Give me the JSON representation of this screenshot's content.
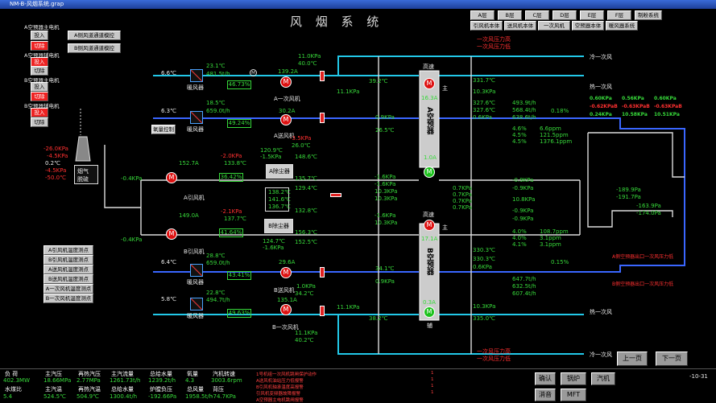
{
  "window": {
    "title": "NM-B-风烟系统.grap"
  },
  "page_title": "风 烟 系 统",
  "area_tabs": [
    "A层",
    "B层",
    "C层",
    "D层",
    "E层",
    "F层",
    "制粉系统"
  ],
  "subsystem_tabs": [
    "引风机本体",
    "送风机本体",
    "一次风机",
    "空预器本体",
    "暖风器系统"
  ],
  "left_controls": {
    "a_heater_main": "A空预器主电机",
    "a_heater_aux": "A空预器辅电机",
    "b_heater_main": "B空预器主电机",
    "b_heater_aux": "B空预器辅电机",
    "input": "投入",
    "switch": "切除",
    "a_duct": "A侧风道通道模控",
    "b_duct": "B侧风道通道模控",
    "o2_ctrl": "氧量控制"
  },
  "stack": {
    "values": [
      "-26.0KPa",
      "-4.5KPa",
      "0.2℃",
      "-4.5KPa",
      "-50.0℃"
    ],
    "desulf": "脱硫",
    "flue": "烟气"
  },
  "temp_buttons": [
    "A引风机温度测点",
    "B引风机温度测点",
    "A送风机温度测点",
    "B送风机温度测点",
    "A一次风机温度测点",
    "B一次风机温度测点"
  ],
  "upper": {
    "a_sec_fan": {
      "in_temp": "6.6℃",
      "heater_t": "23.1℃",
      "flow": "481.5t/h",
      "pct": "46.73%",
      "amp": "139.2A",
      "p": "11.0KPa",
      "t": "40.0℃",
      "name": "A一次风机",
      "heater": "暖风器"
    },
    "a_send_fan": {
      "in_temp": "6.3℃",
      "heater_t": "18.5℃",
      "flow": "659.0t/h",
      "pct": "49.24%",
      "amp": "30.2A",
      "p": "-3.5KPa",
      "t": "26.0℃",
      "name": "A送风机",
      "heater": "暖风器"
    },
    "a_pre": {
      "mid_p": "11.1KPa",
      "t1": "39.2℃",
      "p2": "0.9KPa",
      "t2": "26.5℃",
      "label": "A空预器",
      "speed": "高速",
      "amp": "16.3A",
      "main": "主"
    }
  },
  "lower": {
    "b_send_fan": {
      "in_temp": "6.4℃",
      "heater_t": "28.8℃",
      "flow": "659.0t/h",
      "pct": "43.41%",
      "amp": "29.6A",
      "p": "1.0KPa",
      "t": "34.2℃",
      "name": "B送风机",
      "heater": "暖风器"
    },
    "b_sec_fan": {
      "in_temp": "5.8℃",
      "heater_t": "22.8℃",
      "flow": "494.7t/h",
      "pct": "49.63%",
      "amp": "135.1A",
      "p": "11.1KPa",
      "t": "40.2℃",
      "name": "B一次风机",
      "heater": "暖风器"
    },
    "b_pre": {
      "t1": "34.1℃",
      "p": "0.9KPa",
      "mid_p": "11.1KPa",
      "t2": "38.2℃",
      "label": "B空预器",
      "speed": "高速",
      "amp": "17.1A",
      "aux_amp": "0.3A",
      "aux": "辅",
      "main": "主"
    }
  },
  "induced": {
    "a": {
      "in_p": "-0.4KPa",
      "amp": "152.7A",
      "p": "-2.0KPa",
      "t": "133.8℃",
      "pct": "36.42%",
      "name": "A引风机"
    },
    "b": {
      "in_p": "-0.4KPa",
      "amp": "149.0A",
      "p": "-2.1KPa",
      "t": "137.7℃",
      "pct": "41.64%",
      "name": "B引风机"
    }
  },
  "dust": {
    "a": {
      "label": "A除尘器",
      "t_in": "120.9℃",
      "p_in": "-1.5KPa",
      "t2": "148.6℃",
      "t3": "135.7℃",
      "t4": "129.4℃"
    },
    "b": {
      "label": "B除尘器",
      "t_in": "138.2℃",
      "t2": "141.6℃",
      "t3": "136.7℃",
      "t4": "132.8℃",
      "t5": "156.3℃",
      "t6": "152.5℃",
      "t7": "124.7℃",
      "p": "-1.6KPa"
    }
  },
  "mid_values": [
    "-1.6KPa",
    "-1.6KPa",
    "10.3KPa",
    "10.3KPa",
    "-1.6KPa",
    "10.3KPa",
    "0.7KPa",
    "0.7KPa",
    "0.7KPa",
    "0.7KPa",
    "1.0A"
  ],
  "right": {
    "a_out": {
      "t1": "331.7℃",
      "p1": "10.3KPa",
      "t2": "327.6℃",
      "t3": "327.6℃",
      "p3": "0.6KPa",
      "v1": "493.9t/h",
      "v2": "568.4t/h",
      "v3": "638.6t/h",
      "pct": "0.18%"
    },
    "b_out": {
      "t1": "330.3℃",
      "t2": "330.3℃",
      "p": "0.6KPa",
      "v1": "647.7t/h",
      "v2": "632.5t/h",
      "v3": "607.4t/h",
      "pct": "0.15%",
      "p2": "10.3KPa",
      "t3": "335.0℃"
    },
    "o2": [
      "4.6%",
      "4.5%",
      "4.5%"
    ],
    "o2_b": [
      "4.0%",
      "4.0%",
      "4.1%"
    ],
    "co": [
      "6.6ppm",
      "121.5ppm",
      "1376.1ppm"
    ],
    "co_b": [
      "108.7ppm",
      "3.1ppm",
      "3.1ppm"
    ],
    "flue_p": [
      "-0.9KPa",
      "-0.9KPa",
      "10.8KPa",
      "-0.9KPa",
      "-0.9KPa"
    ],
    "furnace": {
      "t1": "-189.9Pa",
      "t2": "-191.7Pa",
      "t3": "-163.9Pa",
      "t4": "-174.0Pa"
    },
    "wind_p": {
      "row1": [
        "0.60KPa",
        "0.56KPa",
        "0.60KPa"
      ],
      "row2": [
        "-0.62KPaB",
        "-0.63KPaB",
        "-0.63KPaB"
      ],
      "row3": [
        "0.24KPa",
        "10.58KPa",
        "10.51KPa"
      ]
    },
    "cold_air": "冷一次风",
    "hot_air": "热一次风",
    "warn1": "A侧空预器出口一次风压力低",
    "warn2": "B侧空预器出口一次风压力低",
    "pressure_hi": "一次风压力高",
    "pressure_lo": "一次风压力低"
  },
  "nav": {
    "prev": "上一页",
    "next": "下一页"
  },
  "status": {
    "headers": [
      "负 荷",
      "主汽压",
      "再热汽压",
      "主汽流量",
      "总给水量",
      "氧量",
      "汽机转速"
    ],
    "values": [
      "402.3MW",
      "18.66MPa",
      "2.77MPa",
      "1261.73t/h",
      "1239.2t/h",
      "4.3",
      "3003.6rpm"
    ],
    "headers2": [
      "水煤比",
      "主汽温",
      "再热汽温",
      "总给水量",
      "炉膛负压",
      "总风量",
      "背压"
    ],
    "values2": [
      "5.4",
      "524.5℃",
      "504.9℃",
      "1300.4t/h",
      "-192.66Pa",
      "1958.5t/h",
      "-74.7KPa"
    ],
    "alarms": [
      "1号机组一次风机跳闸保护动作",
      "A送风机油站压力低报警",
      "B引风机轴承温度高报警",
      "引风机变频器故障报警",
      "A空预器主电机跳闸报警"
    ],
    "alarm_codes": [
      "1",
      "1",
      "1",
      "1"
    ],
    "confirm": "确认",
    "mute": "消音",
    "boiler": "锅炉",
    "mft": "MFT",
    "turbine": "汽机",
    "date": "-10-31"
  }
}
